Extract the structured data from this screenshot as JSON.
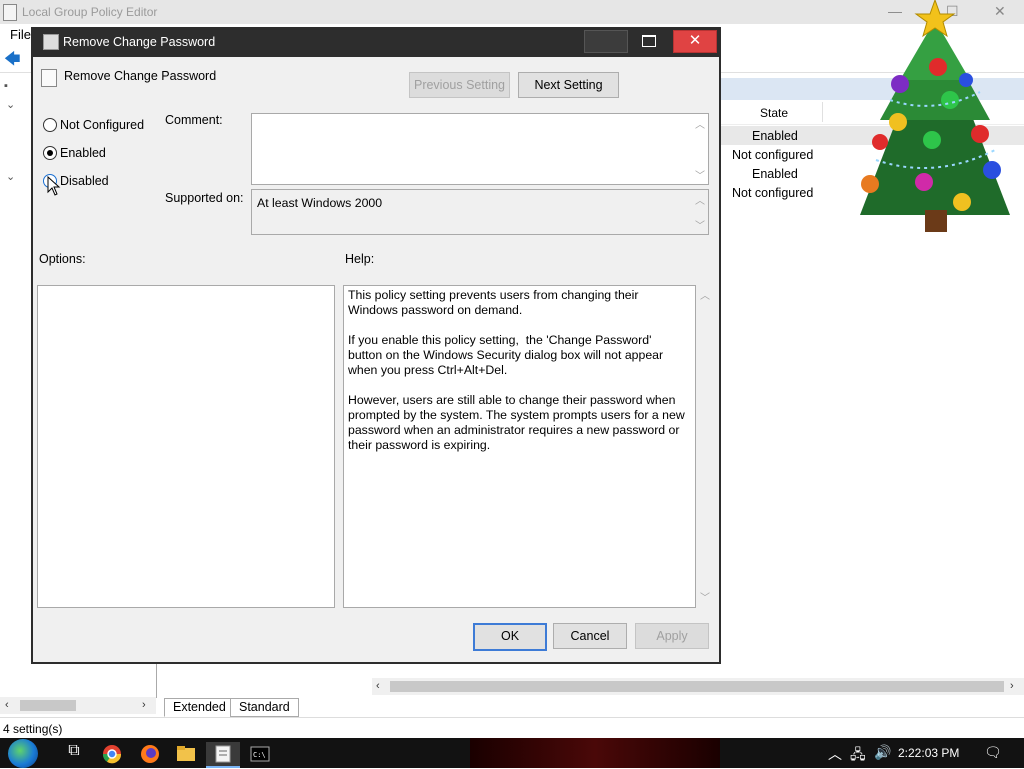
{
  "background_window": {
    "title": "Local Group Policy Editor",
    "menu_file": "File",
    "column_state": "State",
    "states": [
      "Enabled",
      "Not configured",
      "Enabled",
      "Not configured"
    ],
    "tabs": [
      "Extended",
      "Standard"
    ],
    "status": "4 setting(s)"
  },
  "dialog": {
    "title": "Remove Change Password",
    "policy_name": "Remove Change Password",
    "prev_button": "Previous Setting",
    "next_button": "Next Setting",
    "radios": {
      "not_configured": "Not Configured",
      "enabled": "Enabled",
      "disabled": "Disabled",
      "selected": "Enabled"
    },
    "comment_label": "Comment:",
    "comment_value": "",
    "supported_label": "Supported on:",
    "supported_value": "At least Windows 2000",
    "options_label": "Options:",
    "help_label": "Help:",
    "help_text": "This policy setting prevents users from changing their Windows password on demand.\n\nIf you enable this policy setting,  the 'Change Password' button on the Windows Security dialog box will not appear when you press Ctrl+Alt+Del.\n\nHowever, users are still able to change their password when prompted by the system. The system prompts users for a new password when an administrator requires a new password or their password is expiring.",
    "ok_button": "OK",
    "cancel_button": "Cancel",
    "apply_button": "Apply"
  },
  "taskbar": {
    "clock": "2:22:03 PM"
  },
  "colors": {
    "dialog_frame": "#2d2d2d",
    "close_red": "#e04343",
    "accent_blue": "#3d7bd6",
    "list_header": "#dbe6f3"
  }
}
